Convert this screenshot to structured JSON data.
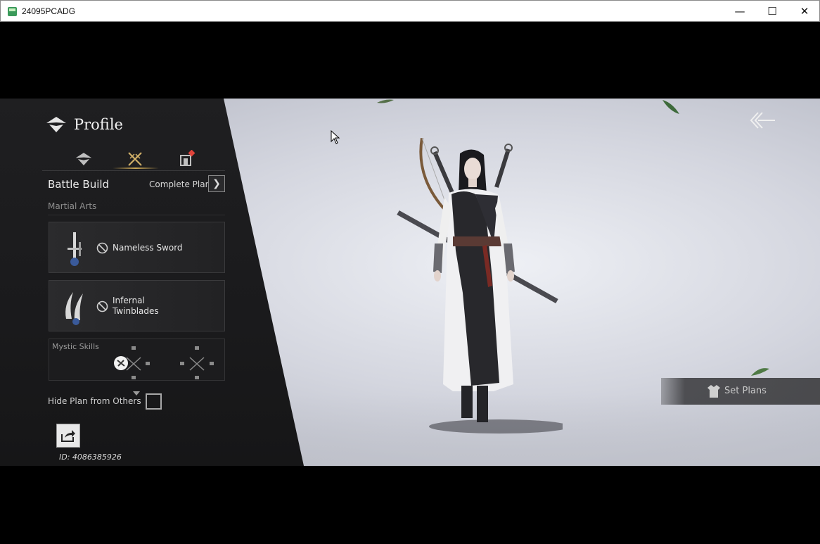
{
  "window": {
    "title": "24095PCADG",
    "minimize_glyph": "—",
    "maximize_glyph": "☐",
    "close_glyph": "✕"
  },
  "panel": {
    "title": "Profile",
    "tabs": [
      {
        "icon": "profile-emblem-icon",
        "active": false
      },
      {
        "icon": "crossed-swords-icon",
        "active": true
      },
      {
        "icon": "banner-icon",
        "active": false,
        "notification": true
      }
    ],
    "section_title": "Battle Build",
    "complete_plan_label": "Complete Plan",
    "subsection_title": "Martial Arts",
    "martial_arts": [
      {
        "label": "Nameless Sword",
        "icon": "sword-icon"
      },
      {
        "label": "Infernal Twinblades",
        "icon": "twinblades-icon"
      }
    ],
    "mystic_skills_label": "Mystic Skills",
    "hide_plan_label": "Hide Plan from Others",
    "hide_plan_checked": false,
    "id_text": "ID: 4086385926"
  },
  "right": {
    "set_plans_label": "Set Plans"
  },
  "colors": {
    "panel_bg": "#1f1f21",
    "accent_gold": "#c9a655",
    "notification_red": "#e0433a"
  }
}
